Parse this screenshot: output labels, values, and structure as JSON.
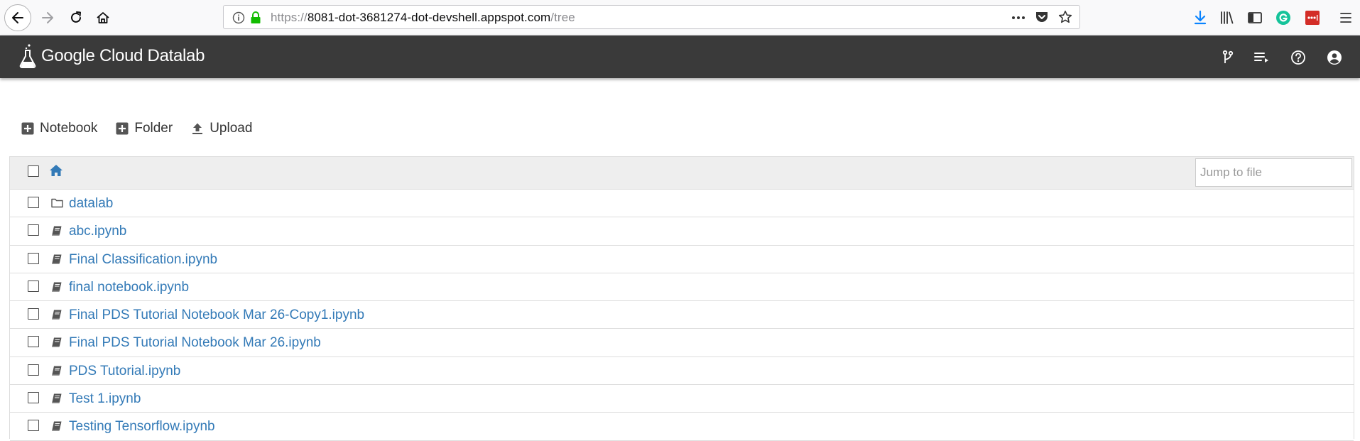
{
  "browser": {
    "url_prefix": "https://",
    "url_host": "8081-dot-3681274-dot-devshell.appspot.com",
    "url_path": "/tree"
  },
  "header": {
    "title": "Google Cloud Datalab"
  },
  "toolbar": {
    "notebook_label": "Notebook",
    "folder_label": "Folder",
    "upload_label": "Upload"
  },
  "file_list": {
    "jump_placeholder": "Jump to file",
    "items": [
      {
        "name": "datalab",
        "icon": "folder-icon"
      },
      {
        "name": "abc.ipynb",
        "icon": "notebook-icon"
      },
      {
        "name": "Final Classification.ipynb",
        "icon": "notebook-icon"
      },
      {
        "name": "final notebook.ipynb",
        "icon": "notebook-icon"
      },
      {
        "name": "Final PDS Tutorial Notebook Mar 26-Copy1.ipynb",
        "icon": "notebook-icon"
      },
      {
        "name": "Final PDS Tutorial Notebook Mar 26.ipynb",
        "icon": "notebook-icon"
      },
      {
        "name": "PDS Tutorial.ipynb",
        "icon": "notebook-icon"
      },
      {
        "name": "Test 1.ipynb",
        "icon": "notebook-icon"
      },
      {
        "name": "Testing Tensorflow.ipynb",
        "icon": "notebook-icon"
      }
    ]
  },
  "colors": {
    "header_bg": "#3a3a3a",
    "link": "#337ab7",
    "list_header_bg": "#eeeeee"
  }
}
